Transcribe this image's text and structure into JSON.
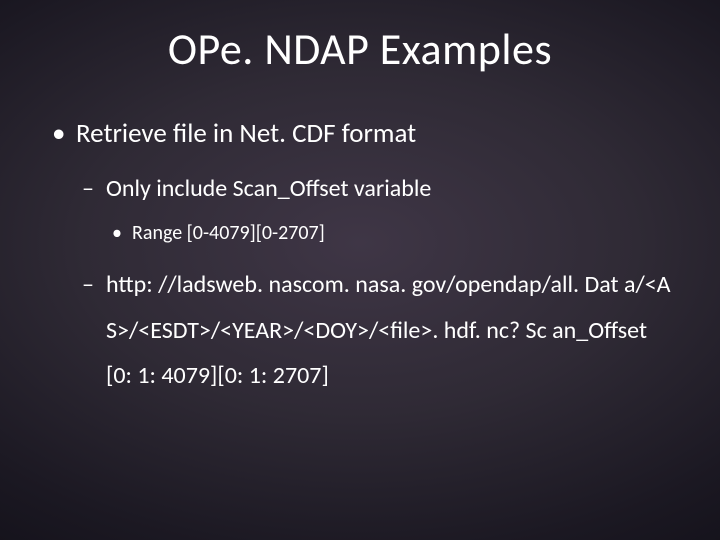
{
  "slide": {
    "title": "OPe. NDAP Examples",
    "bullets": [
      {
        "text": "Retrieve file in Net. CDF format",
        "children": [
          {
            "text": "Only include Scan_Offset variable",
            "children": [
              {
                "text": "Range [0-4079][0-2707]"
              }
            ]
          },
          {
            "text": "http: //ladsweb. nascom. nasa. gov/opendap/all. Dat a/<AS>/<ESDT>/<YEAR>/<DOY>/<file>. hdf. nc? Sc an_Offset[0: 1: 4079][0: 1: 2707]"
          }
        ]
      }
    ]
  }
}
